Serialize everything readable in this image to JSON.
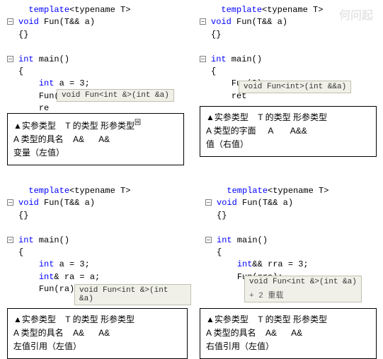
{
  "watermark": "何问起",
  "common": {
    "tmpl": "template",
    "tmpl_param": "<typename T>",
    "fn_sig_prefix": "void",
    "fn_name": "Fun",
    "fn_sig_params": "(T&& a)",
    "braces": "{}",
    "main_sig": "int",
    "main_name": " main()",
    "open": "{",
    "close": "}",
    "decl_a": "int",
    "decl_a_rest": " a = 3;",
    "ret_prefix": "re"
  },
  "q1": {
    "call": "Fun(a);",
    "hint": "void Fun<int &>(int &a)",
    "info_h1": "▲实参类型",
    "info_h2": "T 的类型 形参类型",
    "info_h2_sup": "回",
    "info_r1a": "A 类型的具名",
    "info_r1b": "A&",
    "info_r1c": "A&",
    "info_r2": "变量（左值）"
  },
  "q2": {
    "call": "Fun(3);",
    "ret_prefix": "ret",
    "hint": "void Fun<int>(int &&a)",
    "info_h1": "▲实参类型",
    "info_h2": "T 的类型 形参类型",
    "info_r1a": "A 类型的字面",
    "info_r1b": "A",
    "info_r1c": "A&&",
    "info_r2": "值（右值）"
  },
  "q3": {
    "decl_ra": "int",
    "decl_ra_rest": "& ra = a;",
    "call": "Fun(ra);",
    "hint": "void Fun<int &>(int &a)",
    "info_h1": "▲实参类型",
    "info_h2": "T 的类型 形参类型",
    "info_r1a": "A 类型的具名",
    "info_r1b": "A&",
    "info_r1c": "A&",
    "info_r2": "左值引用（左值）"
  },
  "q4": {
    "decl_rra": "int",
    "decl_rra_rest": "&& rra = 3;",
    "call": "Fun(rra);",
    "hint": "void Fun<int &>(int &a)",
    "hint_extra": "+ 2 重载",
    "info_h1": "▲实参类型",
    "info_h2": "T 的类型 形参类型",
    "info_r1a": "A 类型的具名",
    "info_r1b": "A&",
    "info_r1c": "A&",
    "info_r2": "右值引用（左值）"
  }
}
